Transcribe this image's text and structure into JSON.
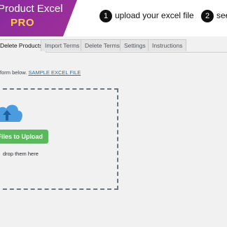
{
  "header": {
    "brand_title": "Product Excel",
    "brand_sub": "PRO",
    "steps": [
      {
        "num": "1",
        "label": "upload your excel file"
      },
      {
        "num": "2",
        "label": "see"
      }
    ]
  },
  "tabs": [
    {
      "label": "Delete Products",
      "active": true
    },
    {
      "label": "Import Terms",
      "active": false
    },
    {
      "label": "Delete Terms",
      "active": false
    },
    {
      "label": "Settings",
      "active": false
    },
    {
      "label": "Instructions",
      "active": false
    }
  ],
  "main": {
    "intro_text": "form below.",
    "sample_link": "SAMPLE EXCEL FILE",
    "upload_button": "Files to Upload",
    "drop_text": "drop them here"
  },
  "colors": {
    "brand": "#8a2a9c",
    "brand_accent": "#ffc94a",
    "upload_button": "#5cb85c",
    "cloud": "#4a9be0"
  }
}
